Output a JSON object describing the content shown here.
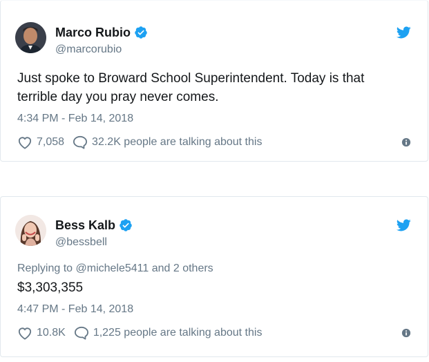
{
  "tweets": [
    {
      "display_name": "Marco Rubio",
      "handle": "@marcorubio",
      "verified": true,
      "reply_to": "",
      "text": "Just spoke to Broward School Superintendent. Today is that terrible day you pray never comes.",
      "timestamp": "4:34 PM - Feb 14, 2018",
      "likes": "7,058",
      "talking": "32.2K people are talking about this",
      "avatar_icon": "avatar-photo"
    },
    {
      "display_name": "Bess Kalb",
      "handle": "@bessbell",
      "verified": true,
      "reply_to": "Replying to @michele5411 and 2 others",
      "text": "$3,303,355",
      "timestamp": "4:47 PM - Feb 14, 2018",
      "likes": "10.8K",
      "talking": "1,225 people are talking about this",
      "avatar_icon": "avatar-photo"
    }
  ],
  "colors": {
    "twitter_blue": "#1da1f2",
    "secondary_text": "#657786",
    "primary_text": "#14171a",
    "border": "#e1e8ed"
  },
  "icons": {
    "verified": "verified-badge-icon",
    "brand": "twitter-bird-icon",
    "like": "heart-icon",
    "reply": "speech-bubble-icon",
    "info": "info-icon"
  }
}
